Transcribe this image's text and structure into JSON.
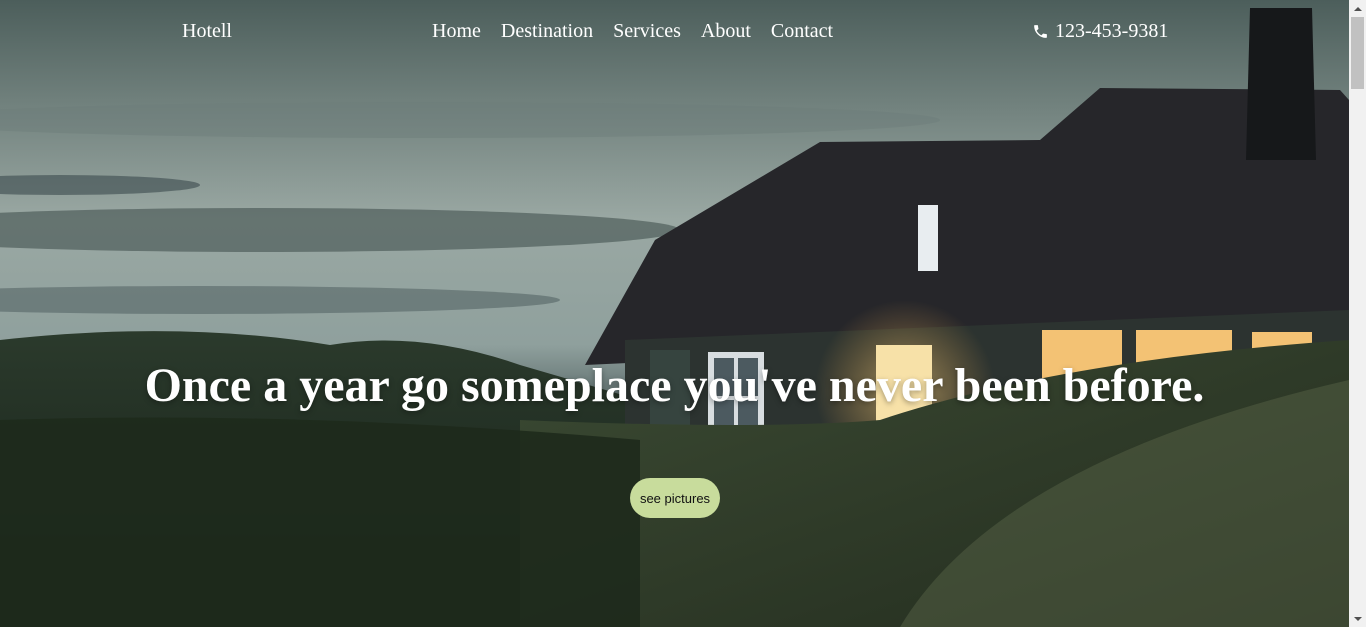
{
  "brand": "Hotell",
  "nav": [
    "Home",
    "Destination",
    "Services",
    "About",
    "Contact"
  ],
  "phone": "123-453-9381",
  "hero": {
    "headline": "Once a year go someplace you've never been before.",
    "cta_label": "see pictures"
  },
  "icons": {
    "phone": "phone-icon",
    "scroll_up": "chevron-up-icon",
    "scroll_down": "chevron-down-icon"
  },
  "colors": {
    "cta_background": "#c8dc9c",
    "text": "#ffffff"
  }
}
